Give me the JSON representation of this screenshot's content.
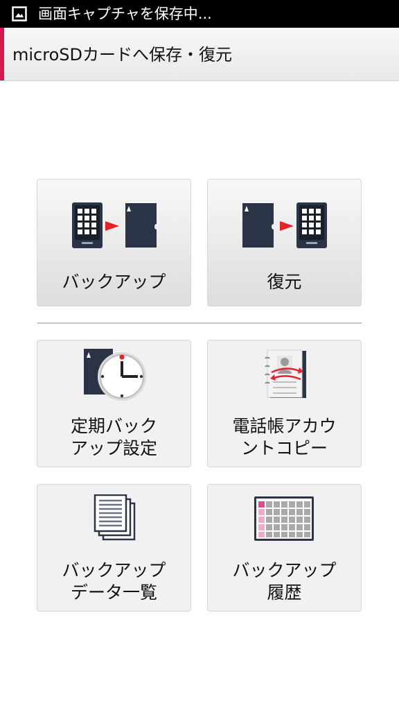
{
  "status_bar": {
    "icon": "screenshot-image-icon",
    "text": "画面キャプチャを保存中..."
  },
  "title_bar": {
    "title": "microSDカードへ保存・復元",
    "accent_color": "#d8194f"
  },
  "tiles": [
    {
      "label": "バックアップ",
      "icon": "phone-to-sdcard-icon"
    },
    {
      "label": "復元",
      "icon": "sdcard-to-phone-icon"
    },
    {
      "label_line1": "定期バック",
      "label_line2": "アップ設定",
      "icon": "scheduled-backup-clock-icon"
    },
    {
      "label_line1": "電話帳アカウ",
      "label_line2": "ントコピー",
      "icon": "phonebook-copy-icon"
    },
    {
      "label_line1": "バックアップ",
      "label_line2": "データ一覧",
      "icon": "document-stack-icon"
    },
    {
      "label_line1": "バックアップ",
      "label_line2": "履歴",
      "icon": "calendar-history-icon"
    }
  ]
}
